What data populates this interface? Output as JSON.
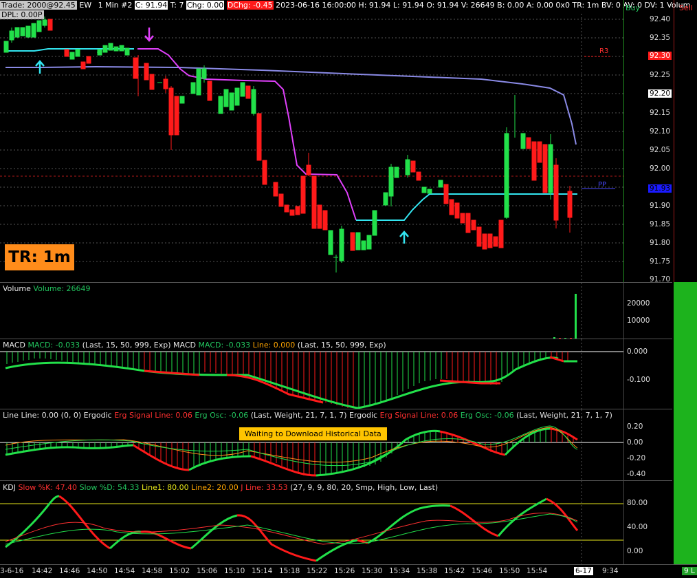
{
  "status_bar": {
    "trade": "Trade: 2000@92.45",
    "symbol": "EW",
    "interval": "1 Min",
    "hash": "#2",
    "close": "C: 91.94",
    "t": "T: 7",
    "chg": "Chg: 0.00",
    "dchg": "DChg: -0.45",
    "details": "2023-06-16 16:00:00 H: 91.94 L: 91.94 O: 91.94 V: 26649 B: 0.00 A: 0.00 0x0 TR: 1m BV: 0 AV: 0 DV: 1 Volum",
    "dpl": "DPL: 0.00P"
  },
  "buttons": {
    "buy": "Buy",
    "sell": "Sell"
  },
  "tr_badge": "TR: 1m",
  "levels": {
    "r3": "R3",
    "pp": "PP",
    "r3_value": "92.30",
    "pp_value": "91.93",
    "last_value": "92.20"
  },
  "price_axis": [
    "92.40",
    "92.35",
    "92.30",
    "92.25",
    "92.20",
    "92.15",
    "92.10",
    "92.05",
    "92.00",
    "91.95",
    "91.90",
    "91.85",
    "91.80",
    "91.75",
    "91.70"
  ],
  "volume": {
    "label": "Volume",
    "value": "Volume: 26649",
    "axis": [
      "20000",
      "10000"
    ]
  },
  "macd": {
    "label1": "MACD",
    "value1": "MACD: -0.033",
    "params1": "(Last, 15, 50, 999, Exp)",
    "label2": "MACD",
    "value2": "MACD: -0.033",
    "line": "Line: 0.000",
    "params2": "(Last, 15, 50, 999, Exp)",
    "axis": [
      "0.000",
      "-0.100"
    ]
  },
  "ergodic": {
    "line": "Line",
    "line_val": "Line: 0.00",
    "zero": "(0, 0)",
    "name1": "Ergodic",
    "sig1": "Erg Signal Line: 0.06",
    "osc1": "Erg Osc: -0.06",
    "params1": "(Last, Weight, 21, 7, 1, 7)",
    "name2": "Ergodic",
    "sig2": "Erg Signal Line: 0.06",
    "osc2": "Erg Osc: -0.06",
    "params2": "(Last, Weight, 21, 7, 1, 7)",
    "notice": "Waiting to Download Historical Data",
    "axis": [
      "0.20",
      "0.00",
      "-0.20",
      "-0.40"
    ]
  },
  "kdj": {
    "label": "KDJ",
    "slowk": "Slow %K: 47.40",
    "slowd": "Slow %D: 54.33",
    "line1": "Line1: 80.00",
    "line2": "Line2: 20.00",
    "jline": "J Line: 33.53",
    "params": "(27, 9, 9, 80, 20, Smp, High, Low, Last)",
    "axis": [
      "80.00",
      "40.00",
      "0.00"
    ]
  },
  "time_axis": [
    "3-6-16",
    "14:42",
    "14:46",
    "14:50",
    "14:54",
    "14:58",
    "15:02",
    "15:06",
    "15:10",
    "15:14",
    "15:18",
    "15:22",
    "15:26",
    "15:30",
    "15:34",
    "15:38",
    "15:42",
    "15:46",
    "15:50",
    "15:54",
    "6-17",
    "9:34"
  ],
  "corner_badge": "9 L",
  "colors": {
    "up": "#22e04a",
    "down": "#ff1a1a",
    "cyan": "#33e5f0",
    "magenta": "#e040fb",
    "slate": "#8a8ae6"
  }
}
